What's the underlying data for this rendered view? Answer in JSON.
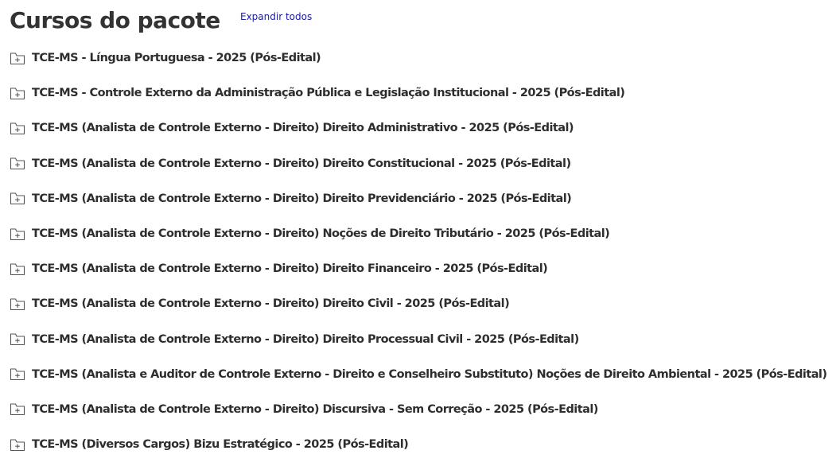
{
  "header": {
    "title": "Cursos do pacote",
    "expand_all_label": "Expandir todos"
  },
  "icons": {
    "course_item": "folder-plus-icon"
  },
  "colors": {
    "title": "#333333",
    "link": "#1a1aa6",
    "item_text": "#2e2e2e",
    "icon_stroke": "#555555"
  },
  "courses": [
    {
      "label": "TCE-MS - Língua Portuguesa - 2025 (Pós-Edital)"
    },
    {
      "label": "TCE-MS - Controle Externo da Administração Pública e Legislação Institucional - 2025 (Pós-Edital)"
    },
    {
      "label": "TCE-MS (Analista de Controle Externo - Direito) Direito Administrativo - 2025 (Pós-Edital)"
    },
    {
      "label": "TCE-MS (Analista de Controle Externo - Direito) Direito Constitucional - 2025 (Pós-Edital)"
    },
    {
      "label": "TCE-MS (Analista de Controle Externo - Direito) Direito Previdenciário - 2025 (Pós-Edital)"
    },
    {
      "label": "TCE-MS (Analista de Controle Externo - Direito) Noções de Direito Tributário - 2025 (Pós-Edital)"
    },
    {
      "label": "TCE-MS (Analista de Controle Externo - Direito) Direito Financeiro - 2025 (Pós-Edital)"
    },
    {
      "label": "TCE-MS (Analista de Controle Externo - Direito) Direito Civil - 2025 (Pós-Edital)"
    },
    {
      "label": "TCE-MS (Analista de Controle Externo - Direito) Direito Processual Civil - 2025 (Pós-Edital)"
    },
    {
      "label": "TCE-MS (Analista e Auditor de Controle Externo - Direito e Conselheiro Substituto) Noções de Direito Ambiental - 2025 (Pós-Edital)"
    },
    {
      "label": "TCE-MS (Analista de Controle Externo - Direito) Discursiva - Sem Correção - 2025 (Pós-Edital)"
    },
    {
      "label": "TCE-MS (Diversos Cargos) Bizu Estratégico - 2025 (Pós-Edital)"
    }
  ]
}
